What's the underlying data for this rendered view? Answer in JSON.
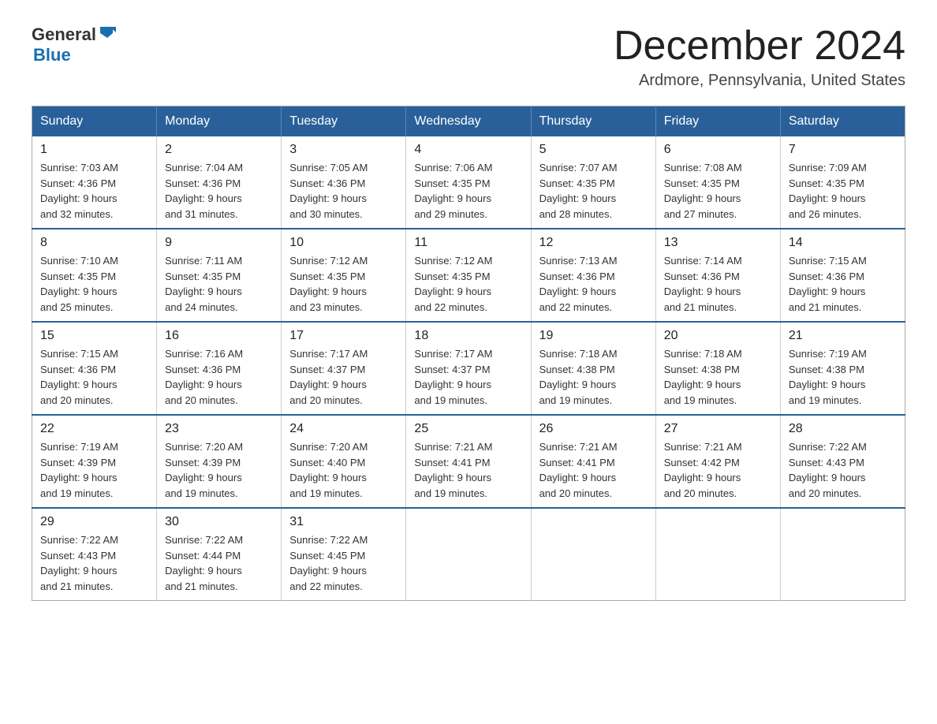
{
  "logo": {
    "general": "General",
    "blue": "Blue",
    "arrow": "▶"
  },
  "title": "December 2024",
  "location": "Ardmore, Pennsylvania, United States",
  "days_of_week": [
    "Sunday",
    "Monday",
    "Tuesday",
    "Wednesday",
    "Thursday",
    "Friday",
    "Saturday"
  ],
  "weeks": [
    [
      {
        "day": "1",
        "sunrise": "7:03 AM",
        "sunset": "4:36 PM",
        "daylight": "9 hours and 32 minutes."
      },
      {
        "day": "2",
        "sunrise": "7:04 AM",
        "sunset": "4:36 PM",
        "daylight": "9 hours and 31 minutes."
      },
      {
        "day": "3",
        "sunrise": "7:05 AM",
        "sunset": "4:36 PM",
        "daylight": "9 hours and 30 minutes."
      },
      {
        "day": "4",
        "sunrise": "7:06 AM",
        "sunset": "4:35 PM",
        "daylight": "9 hours and 29 minutes."
      },
      {
        "day": "5",
        "sunrise": "7:07 AM",
        "sunset": "4:35 PM",
        "daylight": "9 hours and 28 minutes."
      },
      {
        "day": "6",
        "sunrise": "7:08 AM",
        "sunset": "4:35 PM",
        "daylight": "9 hours and 27 minutes."
      },
      {
        "day": "7",
        "sunrise": "7:09 AM",
        "sunset": "4:35 PM",
        "daylight": "9 hours and 26 minutes."
      }
    ],
    [
      {
        "day": "8",
        "sunrise": "7:10 AM",
        "sunset": "4:35 PM",
        "daylight": "9 hours and 25 minutes."
      },
      {
        "day": "9",
        "sunrise": "7:11 AM",
        "sunset": "4:35 PM",
        "daylight": "9 hours and 24 minutes."
      },
      {
        "day": "10",
        "sunrise": "7:12 AM",
        "sunset": "4:35 PM",
        "daylight": "9 hours and 23 minutes."
      },
      {
        "day": "11",
        "sunrise": "7:12 AM",
        "sunset": "4:35 PM",
        "daylight": "9 hours and 22 minutes."
      },
      {
        "day": "12",
        "sunrise": "7:13 AM",
        "sunset": "4:36 PM",
        "daylight": "9 hours and 22 minutes."
      },
      {
        "day": "13",
        "sunrise": "7:14 AM",
        "sunset": "4:36 PM",
        "daylight": "9 hours and 21 minutes."
      },
      {
        "day": "14",
        "sunrise": "7:15 AM",
        "sunset": "4:36 PM",
        "daylight": "9 hours and 21 minutes."
      }
    ],
    [
      {
        "day": "15",
        "sunrise": "7:15 AM",
        "sunset": "4:36 PM",
        "daylight": "9 hours and 20 minutes."
      },
      {
        "day": "16",
        "sunrise": "7:16 AM",
        "sunset": "4:36 PM",
        "daylight": "9 hours and 20 minutes."
      },
      {
        "day": "17",
        "sunrise": "7:17 AM",
        "sunset": "4:37 PM",
        "daylight": "9 hours and 20 minutes."
      },
      {
        "day": "18",
        "sunrise": "7:17 AM",
        "sunset": "4:37 PM",
        "daylight": "9 hours and 19 minutes."
      },
      {
        "day": "19",
        "sunrise": "7:18 AM",
        "sunset": "4:38 PM",
        "daylight": "9 hours and 19 minutes."
      },
      {
        "day": "20",
        "sunrise": "7:18 AM",
        "sunset": "4:38 PM",
        "daylight": "9 hours and 19 minutes."
      },
      {
        "day": "21",
        "sunrise": "7:19 AM",
        "sunset": "4:38 PM",
        "daylight": "9 hours and 19 minutes."
      }
    ],
    [
      {
        "day": "22",
        "sunrise": "7:19 AM",
        "sunset": "4:39 PM",
        "daylight": "9 hours and 19 minutes."
      },
      {
        "day": "23",
        "sunrise": "7:20 AM",
        "sunset": "4:39 PM",
        "daylight": "9 hours and 19 minutes."
      },
      {
        "day": "24",
        "sunrise": "7:20 AM",
        "sunset": "4:40 PM",
        "daylight": "9 hours and 19 minutes."
      },
      {
        "day": "25",
        "sunrise": "7:21 AM",
        "sunset": "4:41 PM",
        "daylight": "9 hours and 19 minutes."
      },
      {
        "day": "26",
        "sunrise": "7:21 AM",
        "sunset": "4:41 PM",
        "daylight": "9 hours and 20 minutes."
      },
      {
        "day": "27",
        "sunrise": "7:21 AM",
        "sunset": "4:42 PM",
        "daylight": "9 hours and 20 minutes."
      },
      {
        "day": "28",
        "sunrise": "7:22 AM",
        "sunset": "4:43 PM",
        "daylight": "9 hours and 20 minutes."
      }
    ],
    [
      {
        "day": "29",
        "sunrise": "7:22 AM",
        "sunset": "4:43 PM",
        "daylight": "9 hours and 21 minutes."
      },
      {
        "day": "30",
        "sunrise": "7:22 AM",
        "sunset": "4:44 PM",
        "daylight": "9 hours and 21 minutes."
      },
      {
        "day": "31",
        "sunrise": "7:22 AM",
        "sunset": "4:45 PM",
        "daylight": "9 hours and 22 minutes."
      },
      null,
      null,
      null,
      null
    ]
  ],
  "labels": {
    "sunrise": "Sunrise: ",
    "sunset": "Sunset: ",
    "daylight": "Daylight: "
  }
}
